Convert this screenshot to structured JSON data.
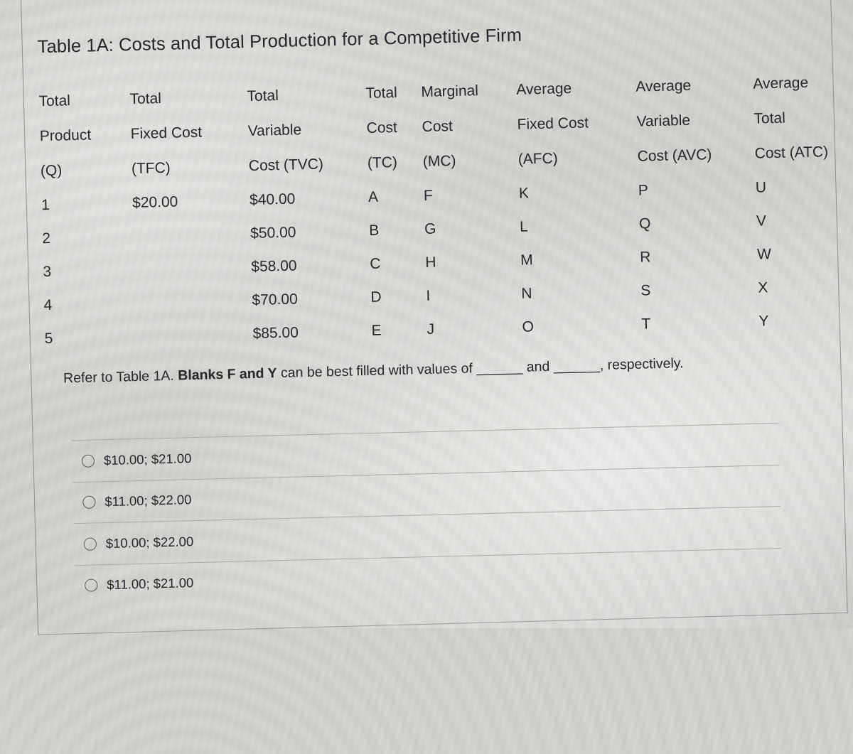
{
  "document": {
    "title": "Table 1A: Costs and Total Production for a Competitive Firm"
  },
  "table": {
    "columns": [
      {
        "line1": "Total",
        "line2": "Product",
        "line3": "(Q)"
      },
      {
        "line1": "Total",
        "line2": "Fixed Cost",
        "line3": "(TFC)"
      },
      {
        "line1": "Total",
        "line2": "Variable",
        "line3": "Cost (TVC)"
      },
      {
        "line1": "Total",
        "line2": "Cost",
        "line3": "(TC)"
      },
      {
        "line1": "Marginal",
        "line2": "Cost",
        "line3": "(MC)"
      },
      {
        "line1": "Average",
        "line2": "Fixed Cost",
        "line3": "(AFC)"
      },
      {
        "line1": "Average",
        "line2": "Variable",
        "line3": "Cost (AVC)"
      },
      {
        "line1": "Average",
        "line2": "Total",
        "line3": "Cost (ATC)"
      }
    ],
    "rows": [
      {
        "q": "1",
        "tfc": "$20.00",
        "tvc": "$40.00",
        "tc": "A",
        "mc": "F",
        "afc": "K",
        "avc": "P",
        "atc": "U"
      },
      {
        "q": "2",
        "tfc": "",
        "tvc": "$50.00",
        "tc": "B",
        "mc": "G",
        "afc": "L",
        "avc": "Q",
        "atc": "V"
      },
      {
        "q": "3",
        "tfc": "",
        "tvc": "$58.00",
        "tc": "C",
        "mc": "H",
        "afc": "M",
        "avc": "R",
        "atc": "W"
      },
      {
        "q": "4",
        "tfc": "",
        "tvc": "$70.00",
        "tc": "D",
        "mc": "I",
        "afc": "N",
        "avc": "S",
        "atc": "X"
      },
      {
        "q": "5",
        "tfc": "",
        "tvc": "$85.00",
        "tc": "E",
        "mc": "J",
        "afc": "O",
        "avc": "T",
        "atc": "Y"
      }
    ]
  },
  "question": {
    "prefix": "Refer to Table 1A. ",
    "bold": "Blanks F and Y",
    "middle": " can be best filled with values of ",
    "blank1": "______",
    "conjunction": " and ",
    "blank2": "______",
    "suffix": ", respectively."
  },
  "options": [
    {
      "label": "$10.00; $21.00",
      "selected": false
    },
    {
      "label": "$11.00; $22.00",
      "selected": false
    },
    {
      "label": "$10.00; $22.00",
      "selected": false
    },
    {
      "label": "$11.00; $21.00",
      "selected": false
    }
  ],
  "style": {
    "text_color": "#24272c",
    "rule_color": "#a9a9a6",
    "page_color": "#d2d2ce"
  }
}
